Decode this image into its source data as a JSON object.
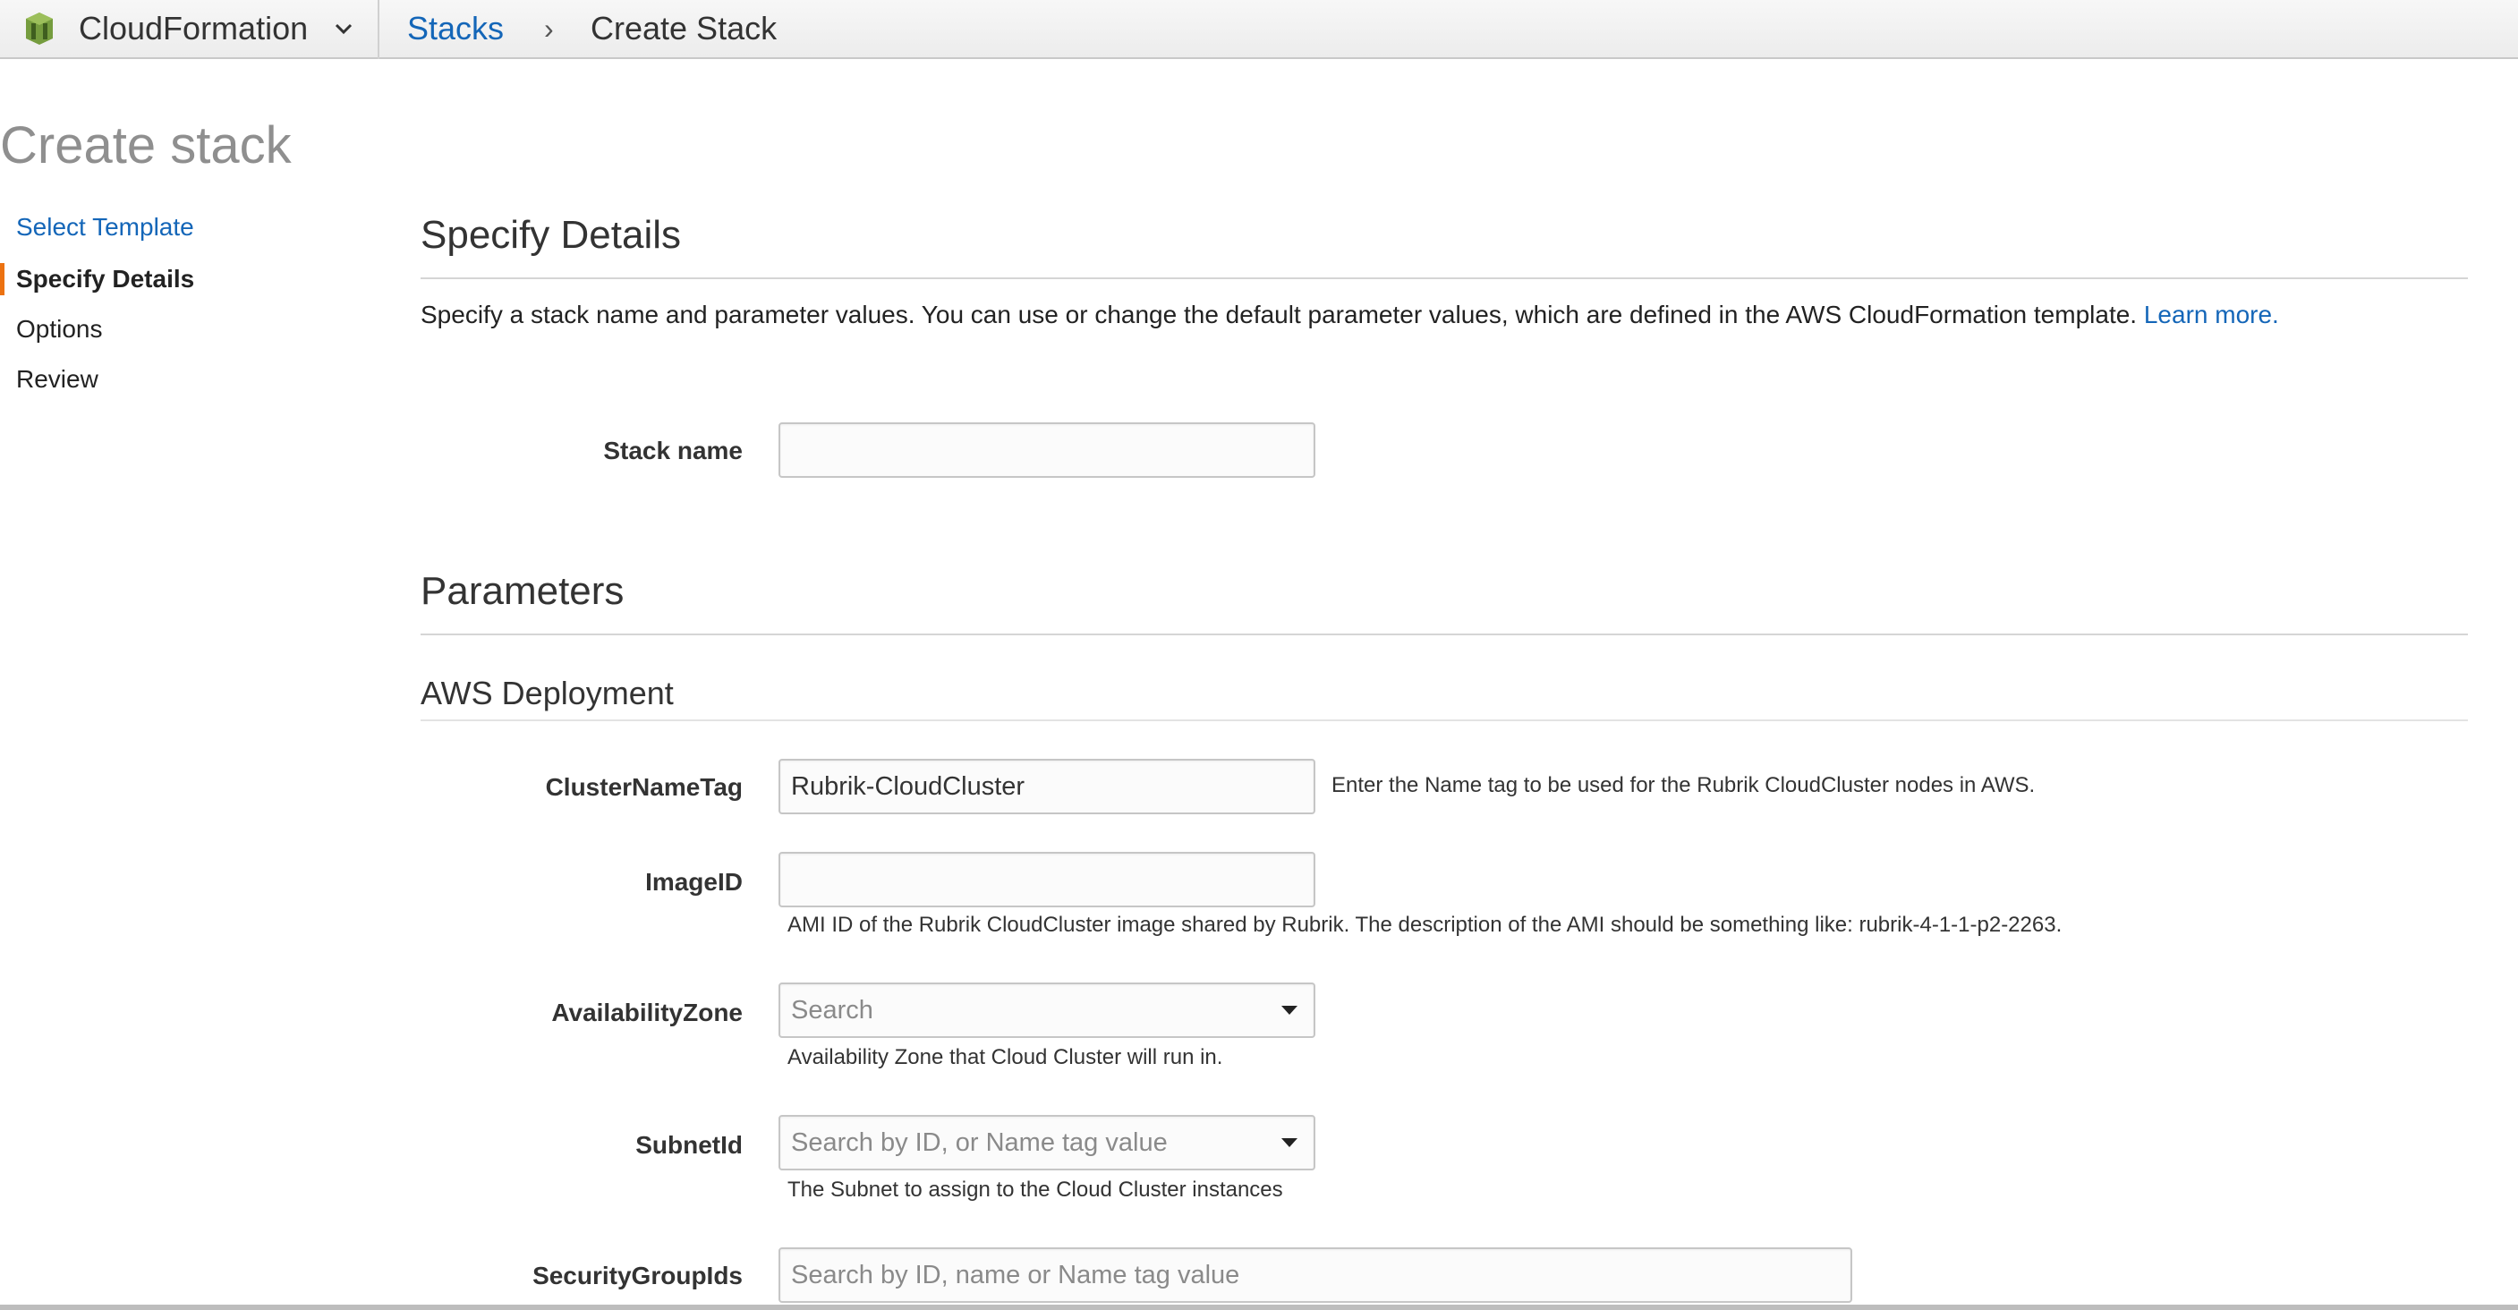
{
  "header": {
    "service_name": "CloudFormation",
    "breadcrumb": {
      "stacks": "Stacks",
      "separator": "›",
      "current": "Create Stack"
    }
  },
  "page_title": "Create stack",
  "wizard_steps": [
    {
      "label": "Select Template",
      "state": "link"
    },
    {
      "label": "Specify Details",
      "state": "active"
    },
    {
      "label": "Options",
      "state": "pending"
    },
    {
      "label": "Review",
      "state": "pending"
    }
  ],
  "specify_details": {
    "title": "Specify Details",
    "description": "Specify a stack name and parameter values. You can use or change the default parameter values, which are defined in the AWS CloudFormation template.",
    "learn_more": "Learn more.",
    "stack_name_label": "Stack name",
    "stack_name_value": ""
  },
  "parameters": {
    "title": "Parameters",
    "group_title": "AWS Deployment",
    "fields": {
      "cluster_name_tag": {
        "label": "ClusterNameTag",
        "value": "Rubrik-CloudCluster",
        "help": "Enter the Name tag to be used for the Rubrik CloudCluster nodes in AWS."
      },
      "image_id": {
        "label": "ImageID",
        "value": "",
        "help": "AMI ID of the Rubrik CloudCluster image shared by Rubrik. The description of the AMI should be something like: rubrik-4-1-1-p2-2263."
      },
      "availability_zone": {
        "label": "AvailabilityZone",
        "placeholder": "Search",
        "help": "Availability Zone that Cloud Cluster will run in."
      },
      "subnet_id": {
        "label": "SubnetId",
        "placeholder": "Search by ID, or Name tag value",
        "help": "The Subnet to assign to the Cloud Cluster instances"
      },
      "security_group_ids": {
        "label": "SecurityGroupIds",
        "placeholder": "Search by ID, name or Name tag value"
      }
    }
  },
  "colors": {
    "link": "#1466b8",
    "active_step_marker": "#ec7211",
    "logo_green": "#6b8e23"
  }
}
